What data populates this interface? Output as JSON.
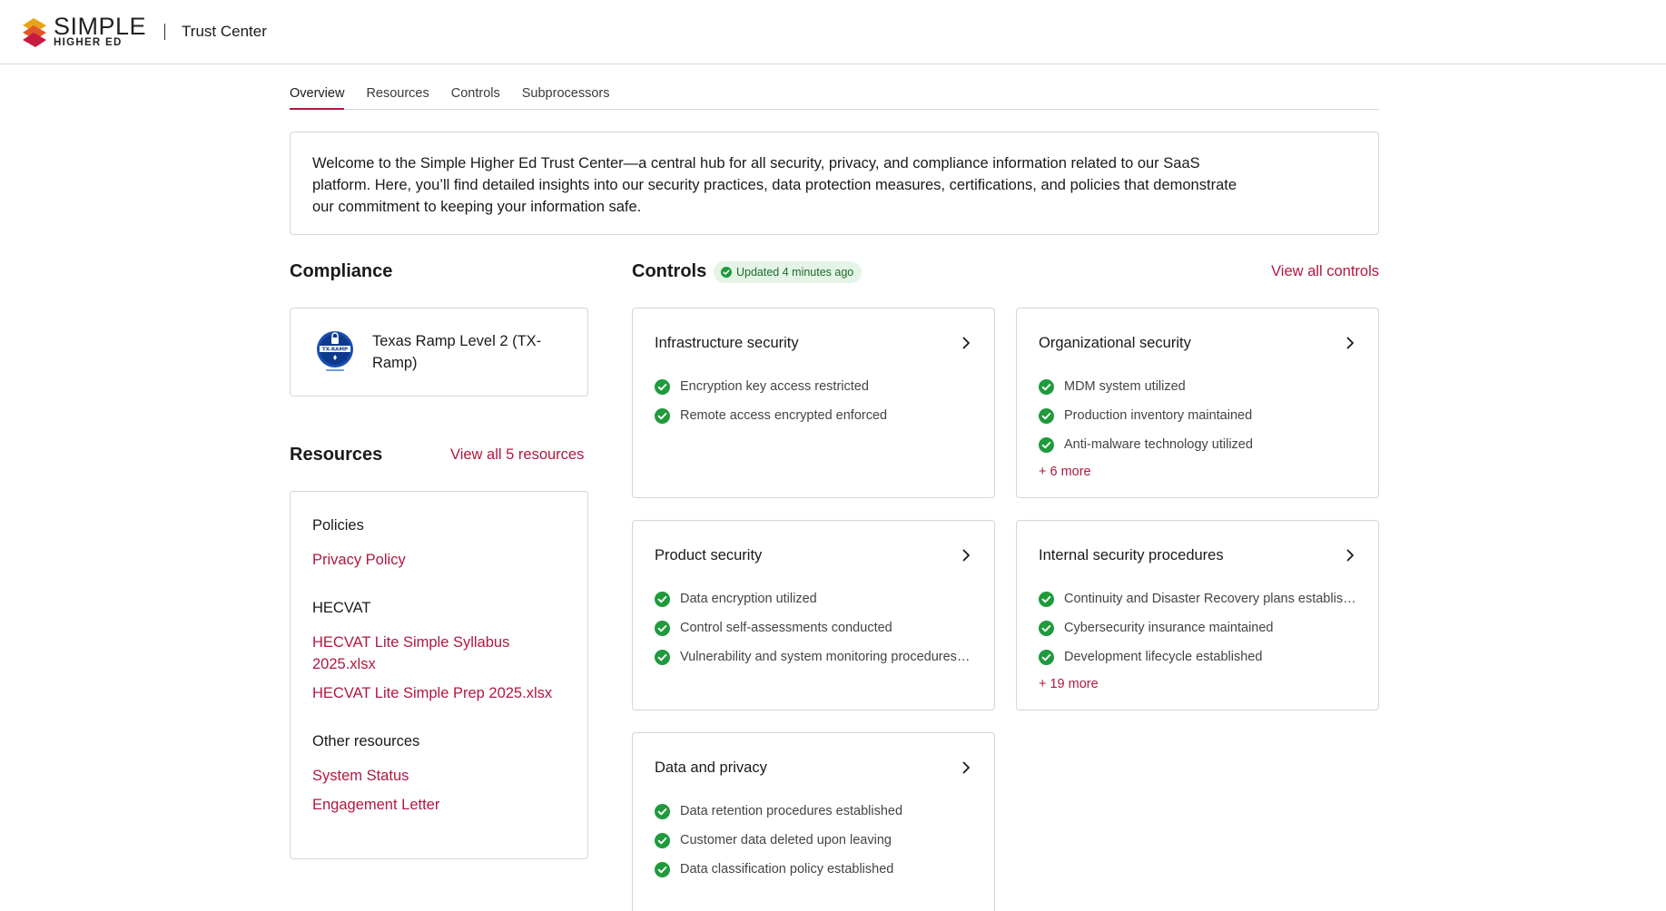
{
  "header": {
    "logo_main": "SIMPLE",
    "logo_sub": "HIGHER ED",
    "title": "Trust Center"
  },
  "tabs": [
    {
      "label": "Overview",
      "active": true
    },
    {
      "label": "Resources",
      "active": false
    },
    {
      "label": "Controls",
      "active": false
    },
    {
      "label": "Subprocessors",
      "active": false
    }
  ],
  "welcome_text": "Welcome to the Simple Higher Ed Trust Center—a central hub for all security, privacy, and compliance information related to our SaaS platform. Here, you’ll find detailed insights into our security practices, data protection measures, certifications, and policies that demonstrate our commitment to keeping your information safe.",
  "compliance": {
    "title": "Compliance",
    "items": [
      {
        "name": "Texas Ramp Level 2 (TX-Ramp)",
        "icon": "tx-ramp-badge-icon",
        "badge_text": "TX-RAMP"
      }
    ]
  },
  "resources": {
    "title": "Resources",
    "view_all": "View all 5 resources",
    "groups": [
      {
        "title": "Policies",
        "links": [
          "Privacy Policy"
        ]
      },
      {
        "title": "HECVAT",
        "links": [
          "HECVAT Lite Simple Syllabus 2025.xlsx",
          "HECVAT Lite Simple Prep 2025.xlsx"
        ]
      },
      {
        "title": "Other resources",
        "links": [
          "System Status",
          "Engagement Letter"
        ]
      }
    ]
  },
  "controls": {
    "title": "Controls",
    "updated": "Updated 4 minutes ago",
    "view_all": "View all controls",
    "cards": [
      {
        "title": "Infrastructure security",
        "items": [
          "Encryption key access restricted",
          "Remote access encrypted enforced"
        ],
        "more": ""
      },
      {
        "title": "Organizational security",
        "items": [
          "MDM system utilized",
          "Production inventory maintained",
          "Anti-malware technology utilized"
        ],
        "more": "+ 6 more"
      },
      {
        "title": "Product security",
        "items": [
          "Data encryption utilized",
          "Control self-assessments conducted",
          "Vulnerability and system monitoring procedures established"
        ],
        "more": ""
      },
      {
        "title": "Internal security procedures",
        "items": [
          "Continuity and Disaster Recovery plans established",
          "Cybersecurity insurance maintained",
          "Development lifecycle established"
        ],
        "more": "+ 19 more"
      },
      {
        "title": "Data and privacy",
        "items": [
          "Data retention procedures established",
          "Customer data deleted upon leaving",
          "Data classification policy established"
        ],
        "more": ""
      }
    ]
  },
  "colors": {
    "accent": "#b3173f",
    "check": "#1f9a3c",
    "border": "#d6d6d6"
  }
}
